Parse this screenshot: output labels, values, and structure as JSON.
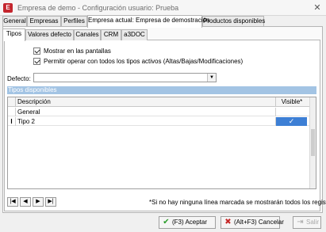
{
  "window": {
    "app_icon_letter": "E",
    "title": "Empresa de demo - Configuración usuario: Prueba",
    "close_glyph": "✕"
  },
  "main_tabs": [
    {
      "label": "General"
    },
    {
      "label": "Empresas"
    },
    {
      "label": "Perfiles"
    },
    {
      "label": "Empresa actual: Empresa de demostración",
      "active": true
    },
    {
      "label": "Productos disponibles"
    }
  ],
  "sub_tabs": [
    {
      "label": "Tipos",
      "active": true
    },
    {
      "label": "Valores defecto"
    },
    {
      "label": "Canales"
    },
    {
      "label": "CRM"
    },
    {
      "label": "a3DOC"
    }
  ],
  "options": {
    "show_in_screens": {
      "label": "Mostrar  en las pantallas",
      "checked": true
    },
    "allow_all_types": {
      "label": "Permitir operar con todos los tipos activos (Altas/Bajas/Modificaciones)",
      "checked": true
    }
  },
  "defecto": {
    "label": "Defecto:",
    "value": ""
  },
  "section": {
    "title": "Tipos disponibles"
  },
  "grid": {
    "columns": {
      "description": "Descripción",
      "visible": "Visible*"
    },
    "rows": [
      {
        "indicator": "",
        "description": "General",
        "visible": false
      },
      {
        "indicator": "I",
        "description": "Tipo 2",
        "visible": true
      }
    ],
    "check_glyph": "✓"
  },
  "nav": {
    "first": "|◀",
    "prev": "◀",
    "next": "▶",
    "last": "▶|"
  },
  "note": "*Si no hay ninguna línea marcada se mostrarán todos los registros",
  "buttons": {
    "accept": {
      "label": "(F3) Aceptar",
      "icon": "check-icon"
    },
    "cancel": {
      "label": "(Alt+F3) Cancelar",
      "icon": "x-icon"
    },
    "exit": {
      "label": "Salir",
      "icon": "exit-icon",
      "enabled": false
    }
  },
  "colors": {
    "section_header": "#a3c4e4",
    "selected_cell": "#3d7fd5",
    "app_icon": "#c4262e"
  }
}
